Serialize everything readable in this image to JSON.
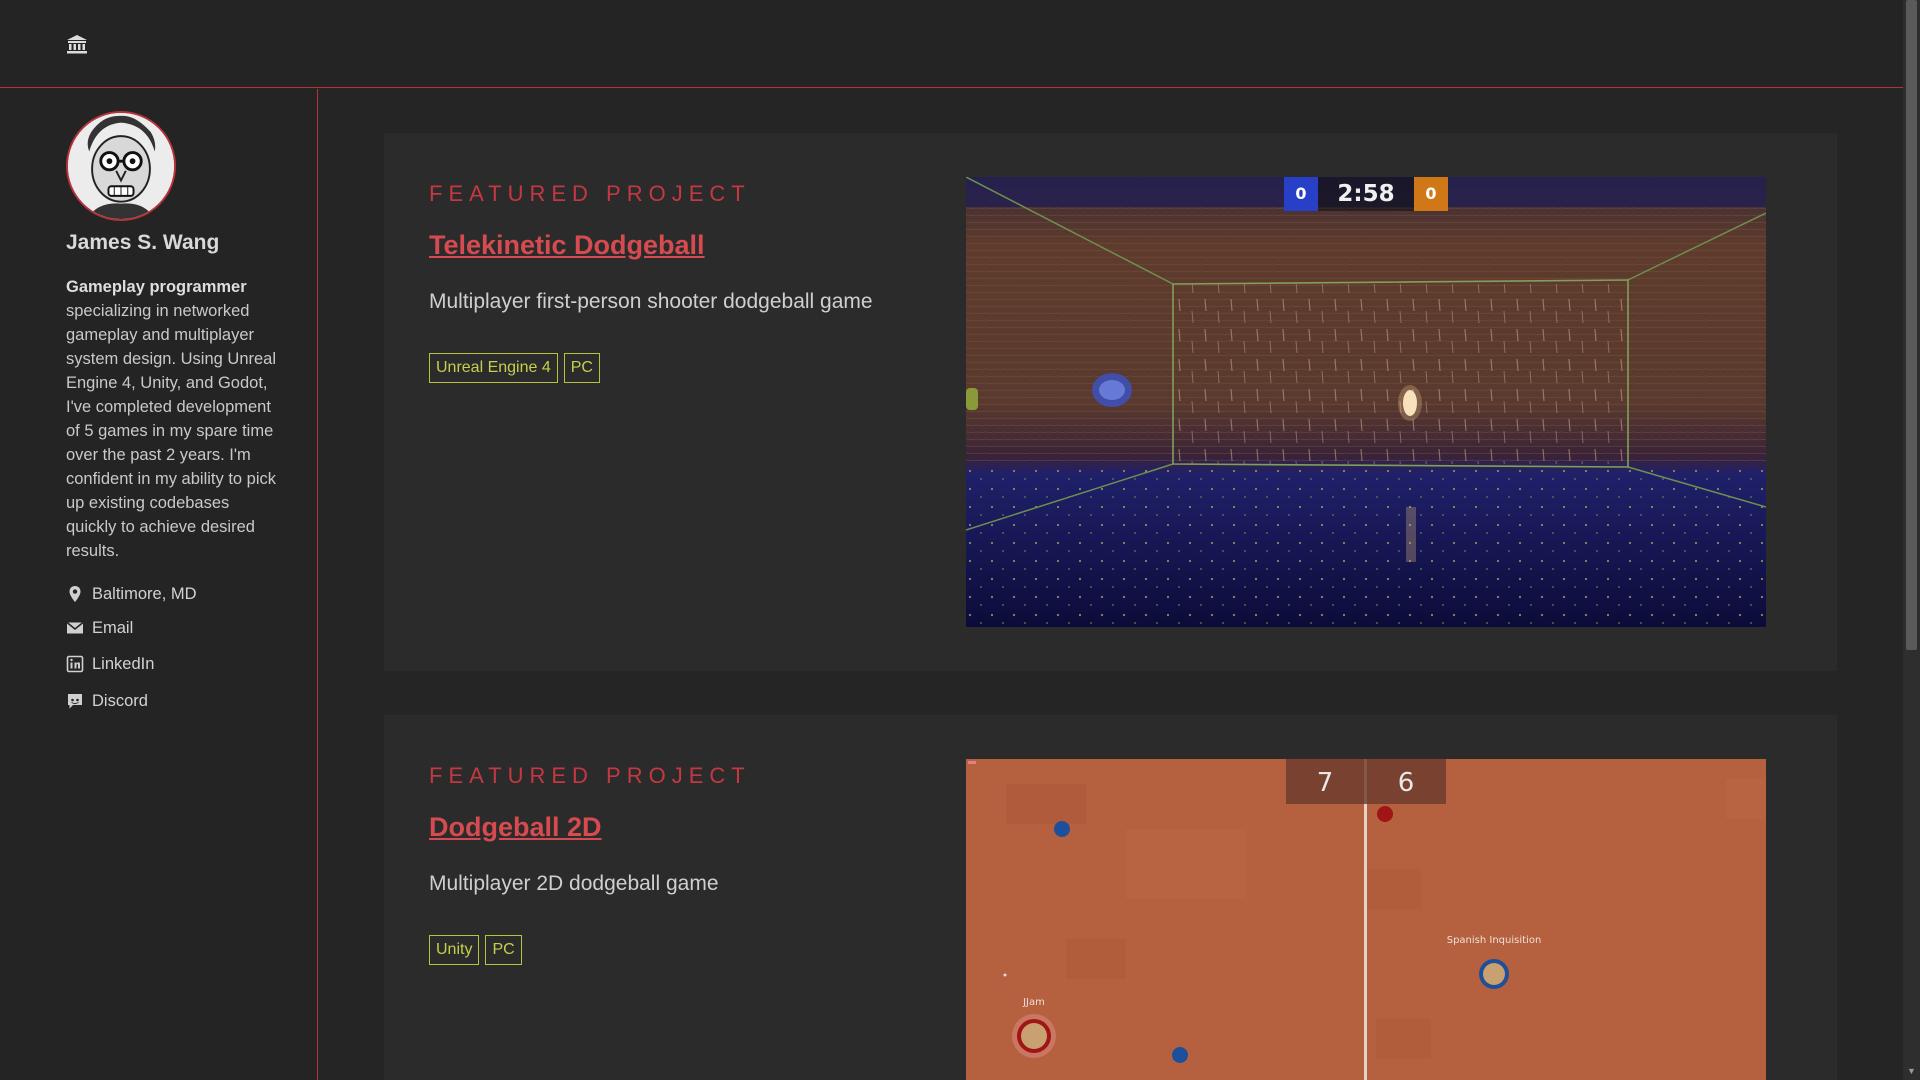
{
  "nav": {
    "home_icon": "bank-building-icon"
  },
  "profile": {
    "name": "James S. Wang",
    "bio_lead": "Gameplay programmer",
    "bio_rest": " specializing in networked gameplay and multiplayer system design. Using Unreal Engine 4, Unity, and Godot, I've completed development of 5 games in my spare time over the past 2 years. I'm confident in my ability to pick up existing codebases quickly to achieve desired results.",
    "contacts": [
      {
        "icon": "location-pin-icon",
        "label": "Baltimore, MD"
      },
      {
        "icon": "envelope-icon",
        "label": "Email"
      },
      {
        "icon": "linkedin-icon",
        "label": "LinkedIn"
      },
      {
        "icon": "discord-icon",
        "label": "Discord"
      }
    ]
  },
  "projects": [
    {
      "eyebrow": "FEATURED PROJECT",
      "title": "Telekinetic Dodgeball",
      "description": "Multiplayer first-person shooter dodgeball game",
      "tags": [
        "Unreal Engine 4",
        "PC"
      ],
      "screenshot": {
        "score_blue": "0",
        "timer": "2:58",
        "score_orange": "0"
      }
    },
    {
      "eyebrow": "FEATURED PROJECT",
      "title": "Dodgeball 2D",
      "description": "Multiplayer 2D dodgeball game",
      "tags": [
        "Unity",
        "PC"
      ],
      "screenshot": {
        "score_left": "7",
        "score_right": "6",
        "player_left": "JJam",
        "player_right": "Spanish Inquisition"
      }
    }
  ],
  "colors": {
    "accent": "#c43841",
    "tag": "#c6cf4a",
    "background": "#252525",
    "card": "#2b2b2b"
  }
}
